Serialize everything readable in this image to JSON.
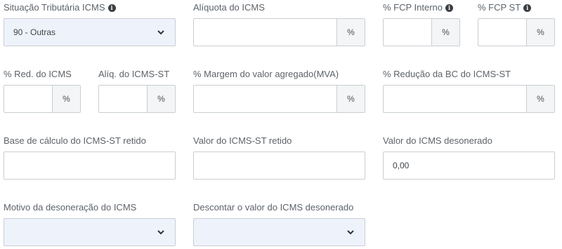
{
  "icms": {
    "situacao": {
      "label": "Situação Tributária ICMS",
      "value": "90 - Outras",
      "icon": "info-icon"
    },
    "aliquota": {
      "label": "Alíquota do ICMS",
      "value": "",
      "suffix": "%"
    },
    "fcp_interno": {
      "label": "% FCP Interno",
      "value": "",
      "suffix": "%",
      "icon": "info-icon"
    },
    "fcp_st": {
      "label": "% FCP ST",
      "value": "",
      "suffix": "%",
      "icon": "info-icon"
    },
    "red_icms": {
      "label": "% Red. do ICMS",
      "value": "",
      "suffix": "%"
    },
    "aliq_icms_st": {
      "label": "Alíq. do ICMS-ST",
      "value": "",
      "suffix": "%"
    },
    "mva": {
      "label": "% Margem do valor agregado(MVA)",
      "value": "",
      "suffix": "%"
    },
    "red_bc_st": {
      "label": "% Redução da BC do ICMS-ST",
      "value": "",
      "suffix": "%"
    },
    "base_st_retido": {
      "label": "Base de cálculo do ICMS-ST retido",
      "value": ""
    },
    "valor_st_retido": {
      "label": "Valor do ICMS-ST retido",
      "value": ""
    },
    "valor_desonerado": {
      "label": "Valor do ICMS desonerado",
      "value": "0,00"
    },
    "motivo_desoneracao": {
      "label": "Motivo da desoneração do ICMS",
      "value": ""
    },
    "descontar_desonerado": {
      "label": "Descontar o valor do ICMS desonerado",
      "value": ""
    }
  },
  "colors": {
    "border": "#c9ced3",
    "select_bg": "#eef3fb",
    "suffix_bg": "#f4f5f6",
    "label": "#5d6369"
  }
}
